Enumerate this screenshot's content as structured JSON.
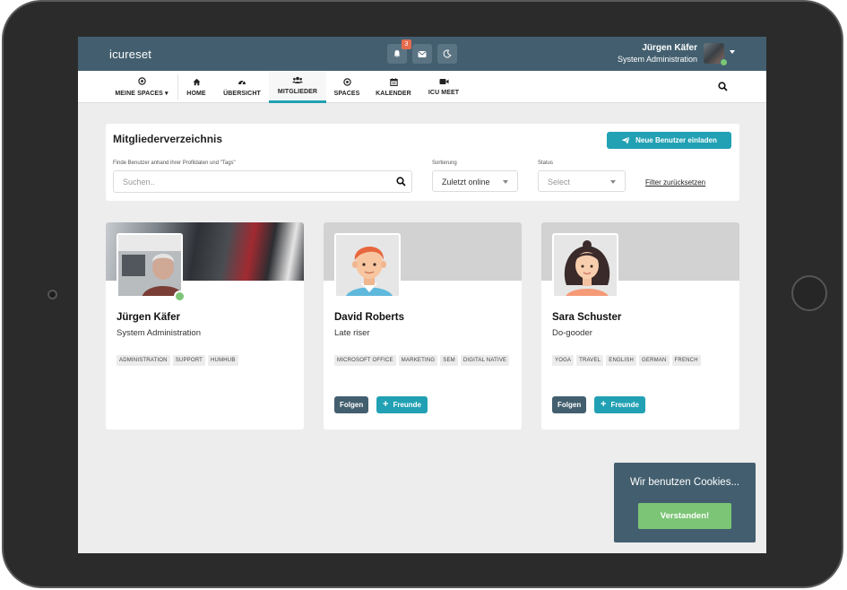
{
  "header": {
    "brand": "icureset",
    "notification_count": "3",
    "user_name": "Jürgen Käfer",
    "user_role": "System Administration"
  },
  "nav": {
    "items": [
      {
        "label": "MEINE SPACES",
        "icon": "target-icon"
      },
      {
        "label": "HOME",
        "icon": "home-icon"
      },
      {
        "label": "ÜBERSICHT",
        "icon": "dashboard-icon"
      },
      {
        "label": "MITGLIEDER",
        "icon": "users-icon"
      },
      {
        "label": "SPACES",
        "icon": "target-icon"
      },
      {
        "label": "KALENDER",
        "icon": "calendar-icon"
      },
      {
        "label": "ICU MEET",
        "icon": "video-icon"
      }
    ],
    "active": "MITGLIEDER"
  },
  "directory": {
    "title": "Mitgliederverzeichnis",
    "invite_label": "Neue Benutzer einladen",
    "search_label": "Finde Benutzer anhand ihrer Profildaten und \"Tags\"",
    "search_placeholder": "Suchen..",
    "sort_label": "Sortierung",
    "sort_value": "Zuletzt online",
    "status_label": "Status",
    "status_placeholder": "Select",
    "reset_label": "Filter zurücksetzen"
  },
  "members": [
    {
      "name": "Jürgen Käfer",
      "role": "System Administration",
      "tags": [
        "ADMINISTRATION",
        "SUPPORT",
        "HUMHUB"
      ],
      "online": true
    },
    {
      "name": "David Roberts",
      "role": "Late riser",
      "tags": [
        "MICROSOFT OFFICE",
        "MARKETING",
        "SEM",
        "DIGITAL NATIVE"
      ],
      "follow_label": "Folgen",
      "friend_label": "Freunde"
    },
    {
      "name": "Sara Schuster",
      "role": "Do-gooder",
      "tags": [
        "YOGA",
        "TRAVEL",
        "ENGLISH",
        "GERMAN",
        "FRENCH"
      ],
      "follow_label": "Folgen",
      "friend_label": "Freunde"
    }
  ],
  "cookie": {
    "text": "Wir benutzen Cookies...",
    "button": "Verstanden!"
  },
  "colors": {
    "primary": "#435f6f",
    "accent": "#21a1b3",
    "success": "#7cc576",
    "badge": "#e56b4f"
  }
}
